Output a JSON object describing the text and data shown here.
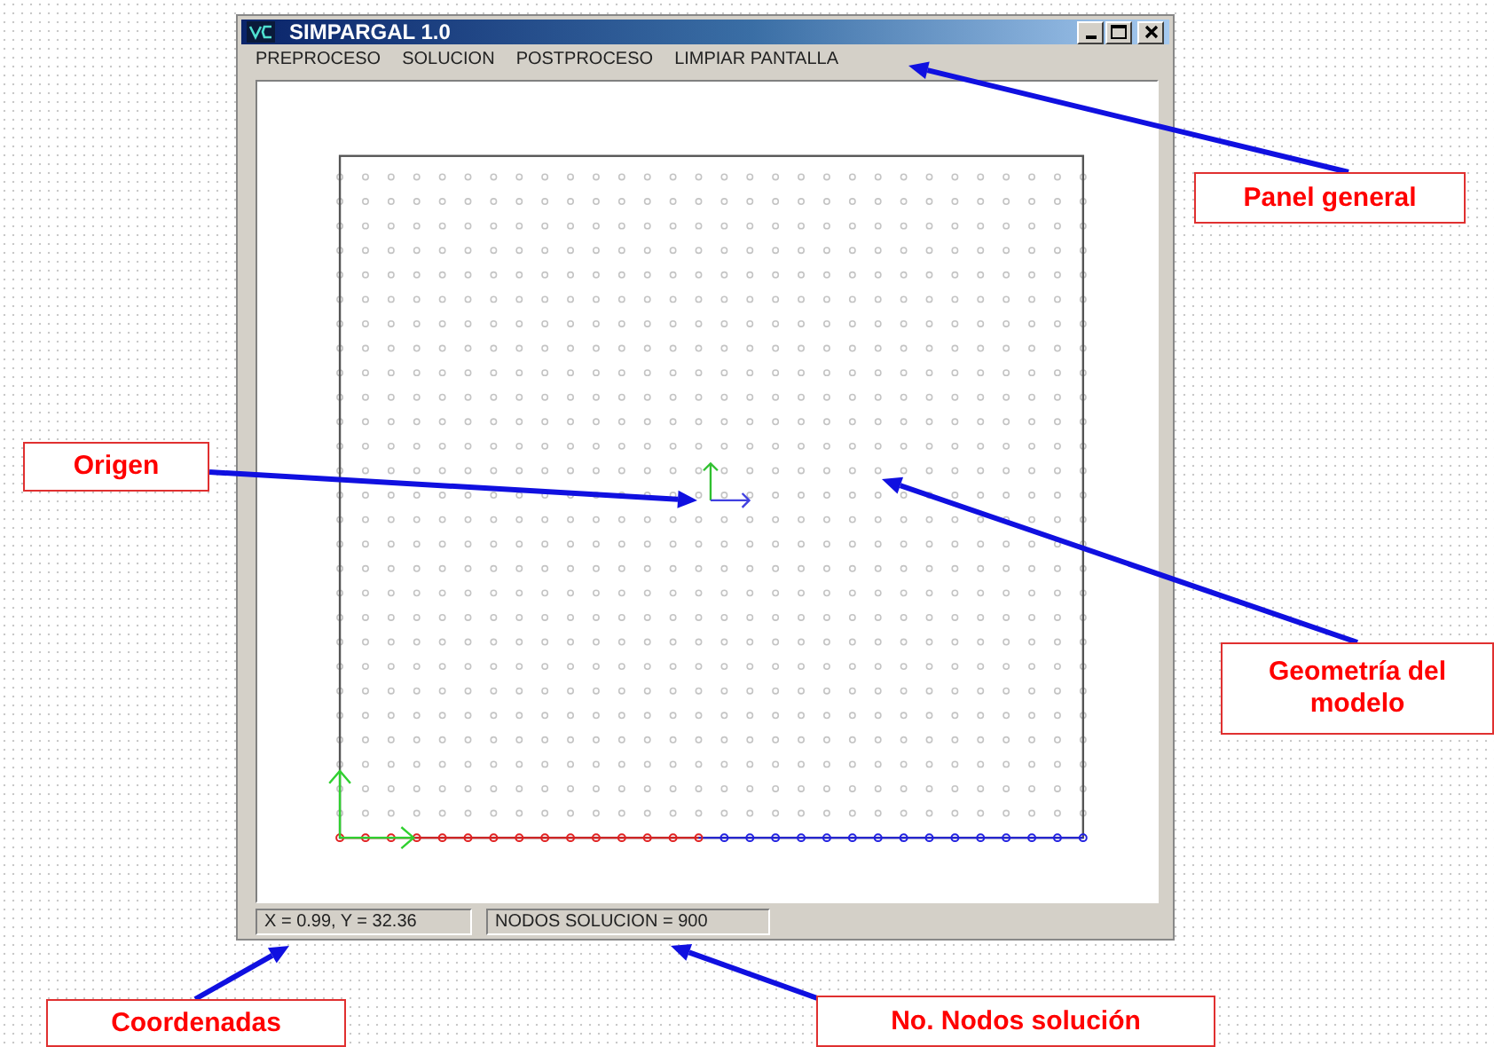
{
  "window": {
    "title": "SIMPARGAL 1.0"
  },
  "menu": [
    "PREPROCESO",
    "SOLUCION",
    "POSTPROCESO",
    "LIMPIAR PANTALLA"
  ],
  "status_bar": [
    "X = 0.99, Y = 32.36",
    "NODOS SOLUCION = 900"
  ],
  "annotations": [
    {
      "text": "Panel general"
    },
    {
      "text": "Origen"
    },
    {
      "text": "Geometría del modelo"
    },
    {
      "text": "Coordenadas"
    },
    {
      "text": "No. Nodos solución"
    }
  ]
}
